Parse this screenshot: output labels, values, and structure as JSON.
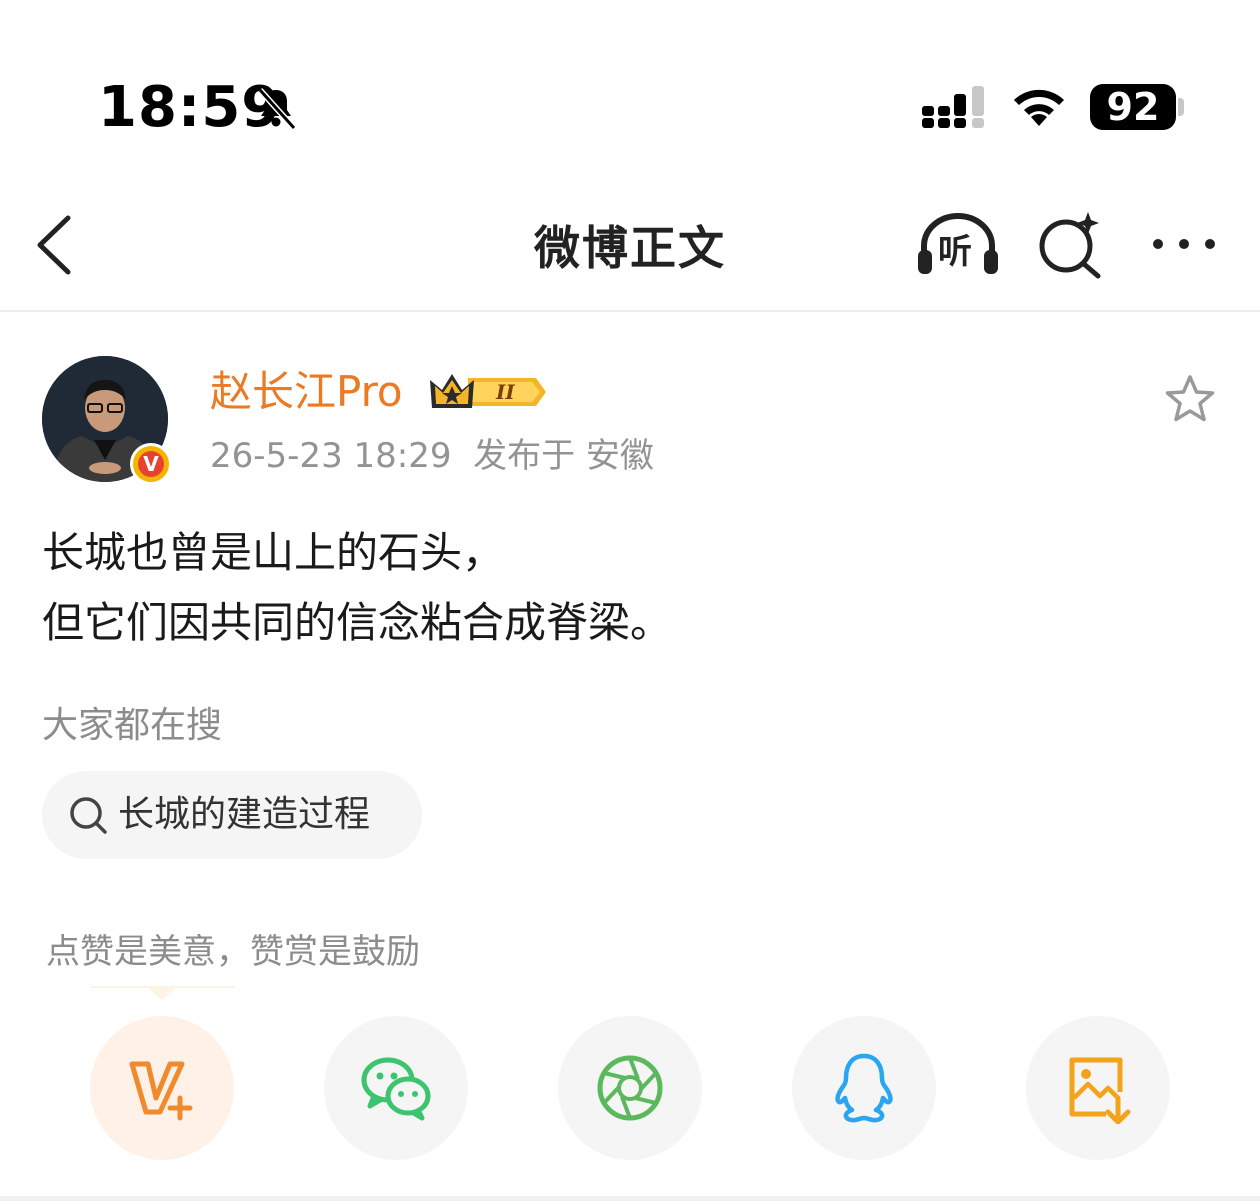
{
  "status_bar": {
    "time": "18:59",
    "battery": "92"
  },
  "nav": {
    "title": "微博正文",
    "listen_label": "听"
  },
  "post": {
    "author": "赵长江Pro",
    "timestamp": "26-5-23 18:29",
    "location": "发布于 安徽",
    "lines": [
      "长城也曾是山上的石头，",
      "但它们因共同的信念粘合成脊梁。"
    ]
  },
  "search_section": {
    "label": "大家都在搜",
    "chip": "长城的建造过程"
  },
  "reward": {
    "label": "点赞是美意，赞赏是鼓励"
  },
  "colors": {
    "accent_orange": "#eb7a23",
    "wechat_green": "#3cc46e",
    "qq_blue": "#2aa6f0",
    "save_orange": "#f2a31a"
  },
  "icons": {
    "share": [
      "v-plus-icon",
      "wechat-icon",
      "moments-icon",
      "qq-icon",
      "save-image-icon"
    ]
  }
}
